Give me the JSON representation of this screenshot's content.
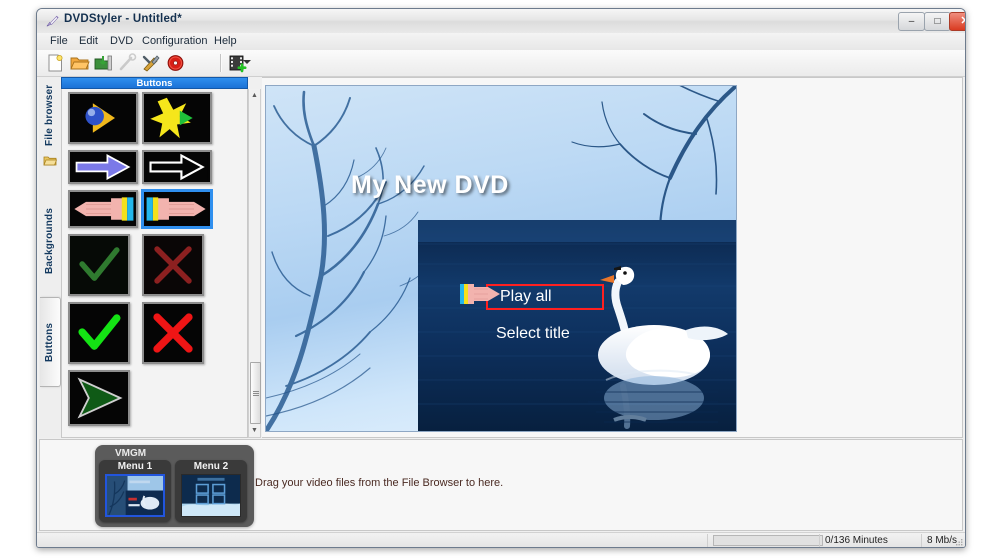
{
  "window": {
    "title": "DVDStyler - Untitled*",
    "app_icon": "paintbrush-icon",
    "controls": {
      "minimize": "–",
      "maximize": "□",
      "close": "✕"
    }
  },
  "menubar": {
    "items": [
      {
        "label": "File"
      },
      {
        "label": "Edit"
      },
      {
        "label": "DVD"
      },
      {
        "label": "Configuration"
      },
      {
        "label": "Help"
      }
    ]
  },
  "toolbar": {
    "items": [
      {
        "name": "new-project-icon",
        "tooltip": "New"
      },
      {
        "name": "open-project-icon",
        "tooltip": "Open"
      },
      {
        "name": "save-project-icon",
        "tooltip": "Save"
      },
      {
        "name": "wand-icon",
        "tooltip": "Wizard",
        "disabled": true
      },
      {
        "name": "tools-icon",
        "tooltip": "Tools"
      },
      {
        "name": "burn-disc-icon",
        "tooltip": "Burn"
      },
      {
        "name": "add-video-icon",
        "tooltip": "Add video"
      }
    ]
  },
  "side_tabs": {
    "items": [
      {
        "label": "File browser",
        "active": false
      },
      {
        "label": "Backgrounds",
        "active": false
      },
      {
        "label": "Buttons",
        "active": true
      }
    ],
    "folder_icon": "folder-icon"
  },
  "gallery": {
    "header": "Buttons",
    "buttons": [
      {
        "name": "arrow-sphere-button",
        "selected": false
      },
      {
        "name": "star-button",
        "selected": false
      },
      {
        "name": "blue-arrow-button",
        "selected": false
      },
      {
        "name": "outline-arrow-button",
        "selected": false
      },
      {
        "name": "hand-left-button",
        "selected": false
      },
      {
        "name": "hand-right-button",
        "selected": true
      },
      {
        "name": "dark-check-button",
        "selected": false
      },
      {
        "name": "dark-cross-button",
        "selected": false
      },
      {
        "name": "green-check-button",
        "selected": false
      },
      {
        "name": "red-cross-button",
        "selected": false
      },
      {
        "name": "green-triangle-button",
        "selected": false
      }
    ],
    "scroll_up": "▲",
    "scroll_down": "▼"
  },
  "canvas": {
    "title": "My New DVD",
    "buttons": [
      {
        "label": "Play all",
        "selected": true,
        "cursor_icon": "hand-pointer-icon"
      },
      {
        "label": "Select title",
        "selected": false
      }
    ]
  },
  "bottom": {
    "group_label": "VMGM",
    "menus": [
      {
        "label": "Menu 1",
        "selected": true
      },
      {
        "label": "Menu 2",
        "selected": false
      }
    ],
    "drag_hint": "Drag your video files from the File Browser to here."
  },
  "statusbar": {
    "progress_percent": 0,
    "time": "0/136 Minutes",
    "bitrate": "8 Mb/s"
  },
  "colors": {
    "accent_blue": "#2f8fee",
    "selection_red": "#ff2020",
    "titlebar_text": "#14304f",
    "close_button": "#d93b21"
  }
}
